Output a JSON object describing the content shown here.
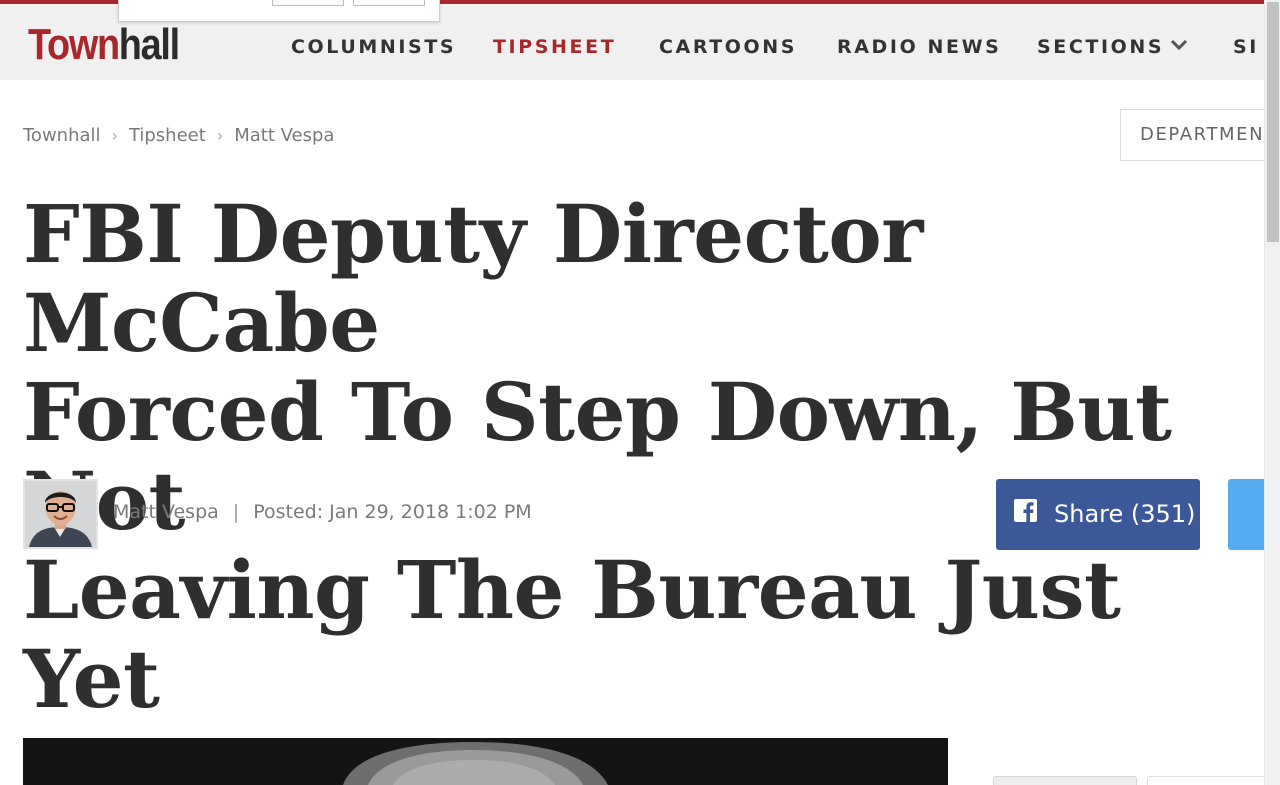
{
  "header": {
    "logo": {
      "part1": "Town",
      "part2": "hall"
    },
    "nav": [
      {
        "label": "COLUMNISTS",
        "active": false
      },
      {
        "label": "TIPSHEET",
        "active": true
      },
      {
        "label": "CARTOONS",
        "active": false
      },
      {
        "label": "RADIO NEWS",
        "active": false
      },
      {
        "label": "SECTIONS",
        "active": false,
        "has_dropdown": true
      },
      {
        "label": "SI",
        "active": false
      }
    ],
    "accent_color": "#a8272b"
  },
  "breadcrumb": [
    "Townhall",
    "Tipsheet",
    "Matt Vespa"
  ],
  "departments_button": "DEPARTMEN",
  "article": {
    "headline_lines": [
      "FBI Deputy Director McCabe",
      "Forced To Step Down, But Not",
      "Leaving The Bureau Just Yet"
    ],
    "author": "Matt Vespa",
    "posted": "Posted: Jan 29, 2018 1:02 PM"
  },
  "share": {
    "facebook_label": "Share (351)",
    "facebook_color": "#3b5998",
    "twitter_color": "#55acee"
  },
  "icons": {
    "facebook": "facebook-f-icon",
    "chevron": "chevron-down-icon"
  }
}
